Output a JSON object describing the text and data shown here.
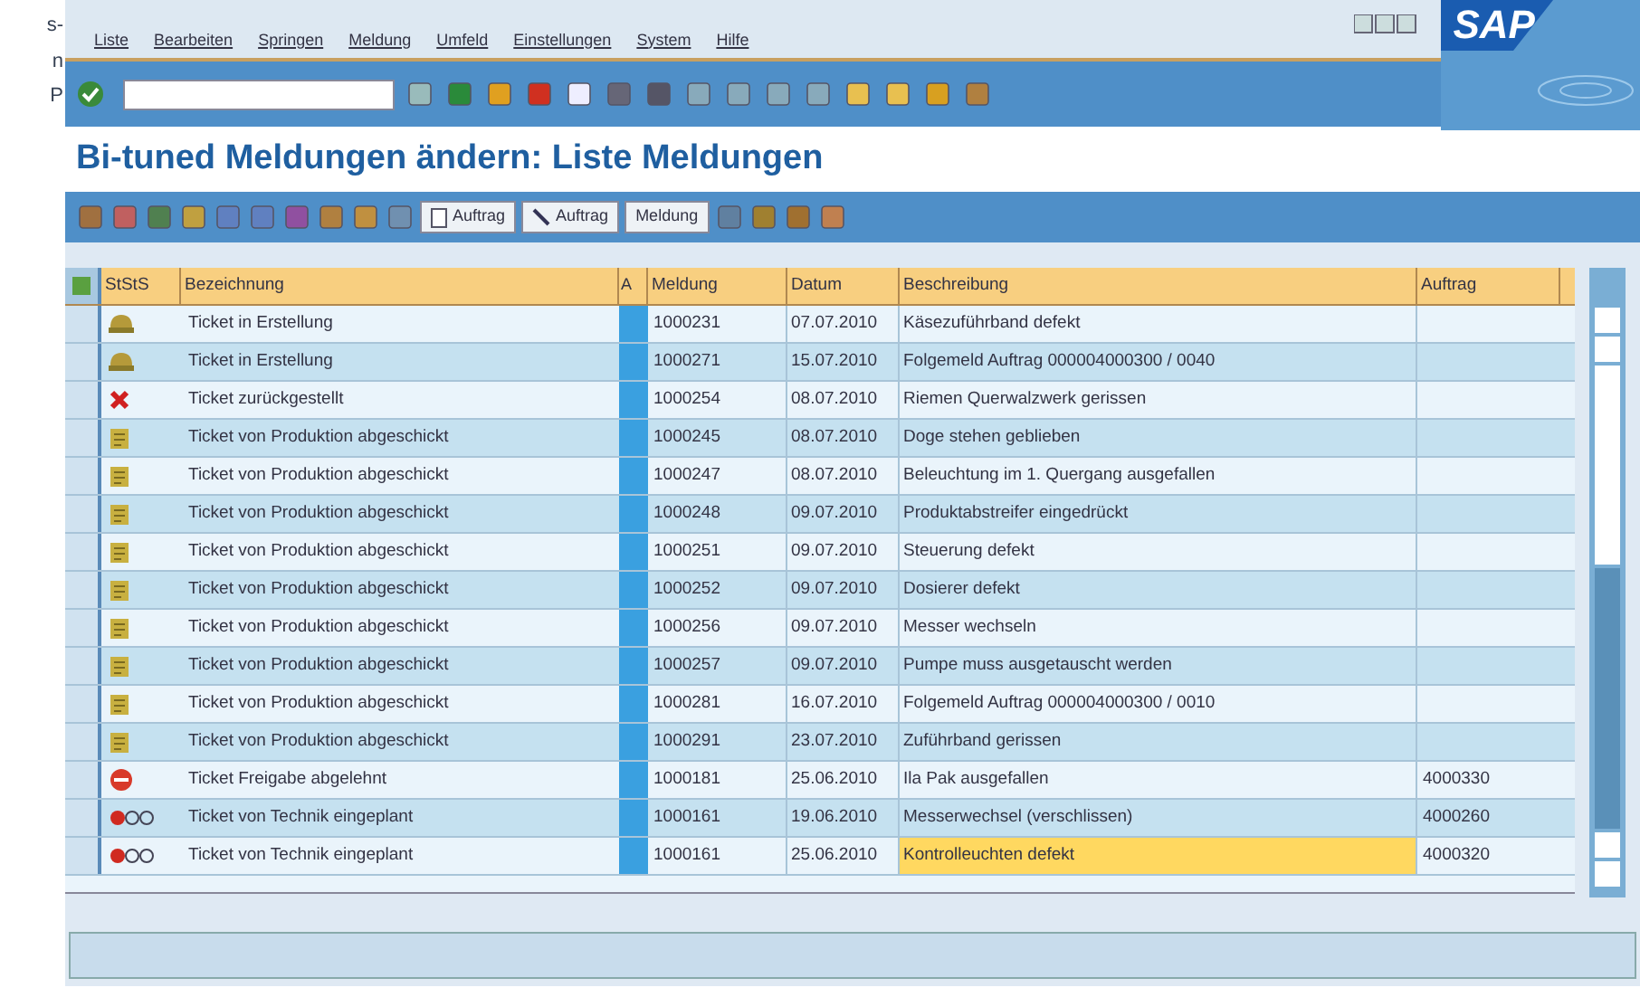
{
  "margin_text": [
    "s-",
    "n",
    "P"
  ],
  "menu": [
    "Liste",
    "Bearbeiten",
    "Springen",
    "Meldung",
    "Umfeld",
    "Einstellungen",
    "System",
    "Hilfe"
  ],
  "logo_text": "SAP",
  "title": "Bi-tuned Meldungen ändern: Liste Meldungen",
  "app_toolbar_buttons": [
    {
      "kind": "doc",
      "label": "Auftrag"
    },
    {
      "kind": "pen",
      "label": "Auftrag"
    },
    {
      "kind": "plain",
      "label": "Meldung"
    }
  ],
  "table": {
    "columns": [
      "StStS",
      "Bezeichnung",
      "A",
      "Meldung",
      "Datum",
      "Beschreibung",
      "Auftrag"
    ],
    "rows": [
      {
        "kind": "construction",
        "bezeichnung": "Ticket in Erstellung",
        "meldung": "1000231",
        "datum": "07.07.2010",
        "beschreibung": "Käsezuführband defekt",
        "selected": false
      },
      {
        "kind": "construction",
        "bezeichnung": "Ticket in Erstellung",
        "meldung": "1000271",
        "datum": "15.07.2010",
        "beschreibung": "Folgemeld Auftrag 000004000300 / 0040",
        "selected": false
      },
      {
        "kind": "cross",
        "bezeichnung": "Ticket zurückgestellt",
        "meldung": "1000254",
        "datum": "08.07.2010",
        "beschreibung": "Riemen Querwalzwerk gerissen",
        "selected": false
      },
      {
        "kind": "sent",
        "bezeichnung": "Ticket von Produktion abgeschickt",
        "meldung": "1000245",
        "datum": "08.07.2010",
        "beschreibung": "Doge stehen geblieben",
        "selected": false
      },
      {
        "kind": "sent",
        "bezeichnung": "Ticket von Produktion abgeschickt",
        "meldung": "1000247",
        "datum": "08.07.2010",
        "beschreibung": "Beleuchtung im 1. Quergang ausgefallen",
        "selected": false
      },
      {
        "kind": "sent",
        "bezeichnung": "Ticket von Produktion abgeschickt",
        "meldung": "1000248",
        "datum": "09.07.2010",
        "beschreibung": "Produktabstreifer eingedrückt",
        "selected": false
      },
      {
        "kind": "sent",
        "bezeichnung": "Ticket von Produktion abgeschickt",
        "meldung": "1000251",
        "datum": "09.07.2010",
        "beschreibung": "Steuerung defekt",
        "selected": false
      },
      {
        "kind": "sent",
        "bezeichnung": "Ticket von Produktion abgeschickt",
        "meldung": "1000252",
        "datum": "09.07.2010",
        "beschreibung": "Dosierer defekt",
        "selected": false
      },
      {
        "kind": "sent",
        "bezeichnung": "Ticket von Produktion abgeschickt",
        "meldung": "1000256",
        "datum": "09.07.2010",
        "beschreibung": "Messer wechseln",
        "selected": false
      },
      {
        "kind": "sent",
        "bezeichnung": "Ticket von Produktion abgeschickt",
        "meldung": "1000257",
        "datum": "09.07.2010",
        "beschreibung": "Pumpe muss ausgetauscht werden",
        "selected": false
      },
      {
        "kind": "sent",
        "bezeichnung": "Ticket von Produktion abgeschickt",
        "meldung": "1000281",
        "datum": "16.07.2010",
        "beschreibung": "Folgemeld Auftrag 000004000300 / 0010",
        "selected": false
      },
      {
        "kind": "sent",
        "bezeichnung": "Ticket von Produktion abgeschickt",
        "meldung": "1000291",
        "datum": "23.07.2010",
        "beschreibung": "Zuführband gerissen",
        "selected": false
      },
      {
        "kind": "stop",
        "bezeichnung": "Ticket Freigabe abgelehnt",
        "meldung": "1000181",
        "datum": "25.06.2010",
        "beschreibung": "Ila Pak ausgefallen",
        "auftrag": "4000330",
        "selected": false
      },
      {
        "kind": "light",
        "bezeichnung": "Ticket von Technik eingeplant",
        "meldung": "1000161",
        "datum": "19.06.2010",
        "beschreibung": "Messerwechsel (verschlissen)",
        "auftrag": "4000260",
        "selected": false
      },
      {
        "kind": "light",
        "bezeichnung": "Ticket von Technik eingeplant",
        "meldung": "1000161",
        "datum": "25.06.2010",
        "beschreibung": "Kontrolleuchten defekt",
        "auftrag": "4000320",
        "selected": true
      }
    ]
  }
}
